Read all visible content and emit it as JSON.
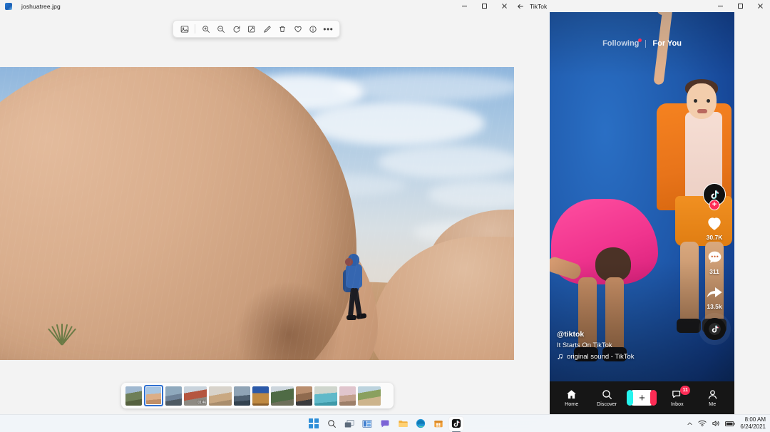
{
  "photos_window": {
    "title": "joshuatree.jpg",
    "app_icon": "photos-app-icon",
    "window_controls": {
      "minimize": "minimize-icon",
      "maximize": "maximize-icon",
      "close": "close-icon"
    },
    "toolbar": {
      "items": [
        {
          "name": "fit-to-window",
          "icon": "fit-to-window-icon",
          "label": "Fit to window"
        },
        {
          "name": "zoom-in",
          "icon": "zoom-in-icon",
          "label": "Zoom in"
        },
        {
          "name": "zoom-out",
          "icon": "zoom-out-icon",
          "label": "Zoom out"
        },
        {
          "name": "rotate",
          "icon": "rotate-icon",
          "label": "Rotate"
        },
        {
          "name": "crop",
          "icon": "crop-edit-icon",
          "label": "Crop"
        },
        {
          "name": "edit",
          "icon": "pencil-icon",
          "label": "Edit"
        },
        {
          "name": "delete",
          "icon": "trash-icon",
          "label": "Delete"
        },
        {
          "name": "favorite",
          "icon": "heart-icon",
          "label": "Add to favorites"
        },
        {
          "name": "info",
          "icon": "info-icon",
          "label": "File info"
        },
        {
          "name": "more",
          "icon": "ellipsis-icon",
          "label": "See more"
        }
      ]
    },
    "image": {
      "alt": "Hiker with child carrier walking among large granite boulders in Joshua Tree desert under a partly cloudy sky"
    },
    "filmstrip": {
      "selected_index": 1,
      "thumbnails": [
        {
          "name": "thumb-canyon",
          "duration": ""
        },
        {
          "name": "thumb-joshuatree",
          "duration": ""
        },
        {
          "name": "thumb-lake",
          "duration": ""
        },
        {
          "name": "thumb-video-train",
          "duration": "01:46"
        },
        {
          "name": "thumb-desert",
          "duration": ""
        },
        {
          "name": "thumb-sunset-water",
          "duration": ""
        },
        {
          "name": "thumb-dog",
          "duration": ""
        },
        {
          "name": "thumb-palms",
          "duration": ""
        },
        {
          "name": "thumb-interior",
          "duration": ""
        },
        {
          "name": "thumb-pool",
          "duration": ""
        },
        {
          "name": "thumb-dunes",
          "duration": ""
        },
        {
          "name": "thumb-beach",
          "duration": ""
        }
      ]
    }
  },
  "tiktok_window": {
    "title": "TikTok",
    "back_icon": "back-arrow-icon",
    "window_controls": {
      "minimize": "minimize-icon",
      "maximize": "maximize-icon",
      "close": "close-icon"
    },
    "feed_tabs": [
      {
        "name": "tab-following",
        "label": "Following",
        "active": false,
        "has_notification_dot": true
      },
      {
        "name": "tab-for-you",
        "label": "For You",
        "active": true,
        "has_notification_dot": false
      }
    ],
    "video": {
      "alt": "Two people in bright orange and pink outfits dancing against a blue backdrop"
    },
    "actions": {
      "profile": {
        "name": "creator-avatar",
        "follow_label": "+"
      },
      "like": {
        "icon": "heart-icon",
        "count": "30.7K"
      },
      "comment": {
        "icon": "comment-icon",
        "count": "311"
      },
      "share": {
        "icon": "share-arrow-icon",
        "count": "13.5k"
      },
      "sound_disc": {
        "icon": "music-disc-icon"
      }
    },
    "caption": {
      "username": "@tiktok",
      "description": "It Starts On TikTok",
      "music_icon": "music-note-icon",
      "music": "original sound - TikTok"
    },
    "bottom_nav": [
      {
        "name": "nav-home",
        "label": "Home",
        "icon": "home-icon",
        "badge": ""
      },
      {
        "name": "nav-discover",
        "label": "Discover",
        "icon": "search-icon",
        "badge": ""
      },
      {
        "name": "nav-create",
        "label": "",
        "icon": "plus-icon",
        "badge": ""
      },
      {
        "name": "nav-inbox",
        "label": "Inbox",
        "icon": "inbox-message-icon",
        "badge": "11"
      },
      {
        "name": "nav-me",
        "label": "Me",
        "icon": "person-icon",
        "badge": ""
      }
    ]
  },
  "taskbar": {
    "items": [
      {
        "name": "start-button",
        "icon": "windows-logo-icon",
        "active": false
      },
      {
        "name": "search-button",
        "icon": "search-icon",
        "active": false
      },
      {
        "name": "task-view-button",
        "icon": "task-view-icon",
        "active": false
      },
      {
        "name": "widgets-button",
        "icon": "widgets-icon",
        "active": false
      },
      {
        "name": "chat-button",
        "icon": "chat-icon",
        "active": false
      },
      {
        "name": "file-explorer-button",
        "icon": "folder-icon",
        "active": false
      },
      {
        "name": "edge-button",
        "icon": "edge-browser-icon",
        "active": false
      },
      {
        "name": "store-button",
        "icon": "microsoft-store-icon",
        "active": false
      },
      {
        "name": "tiktok-taskbar-button",
        "icon": "tiktok-icon",
        "active": true
      }
    ],
    "tray": {
      "chevron": "chevron-up-icon",
      "wifi": "wifi-icon",
      "volume": "volume-icon",
      "battery": "battery-icon",
      "time": "8:00 AM",
      "date": "6/24/2021"
    }
  },
  "colors": {
    "tiktok_red": "#fe2c55",
    "tiktok_cyan": "#25f4ee",
    "accent_blue": "#2e6fd0",
    "window_chrome": "#f3f3f3"
  }
}
